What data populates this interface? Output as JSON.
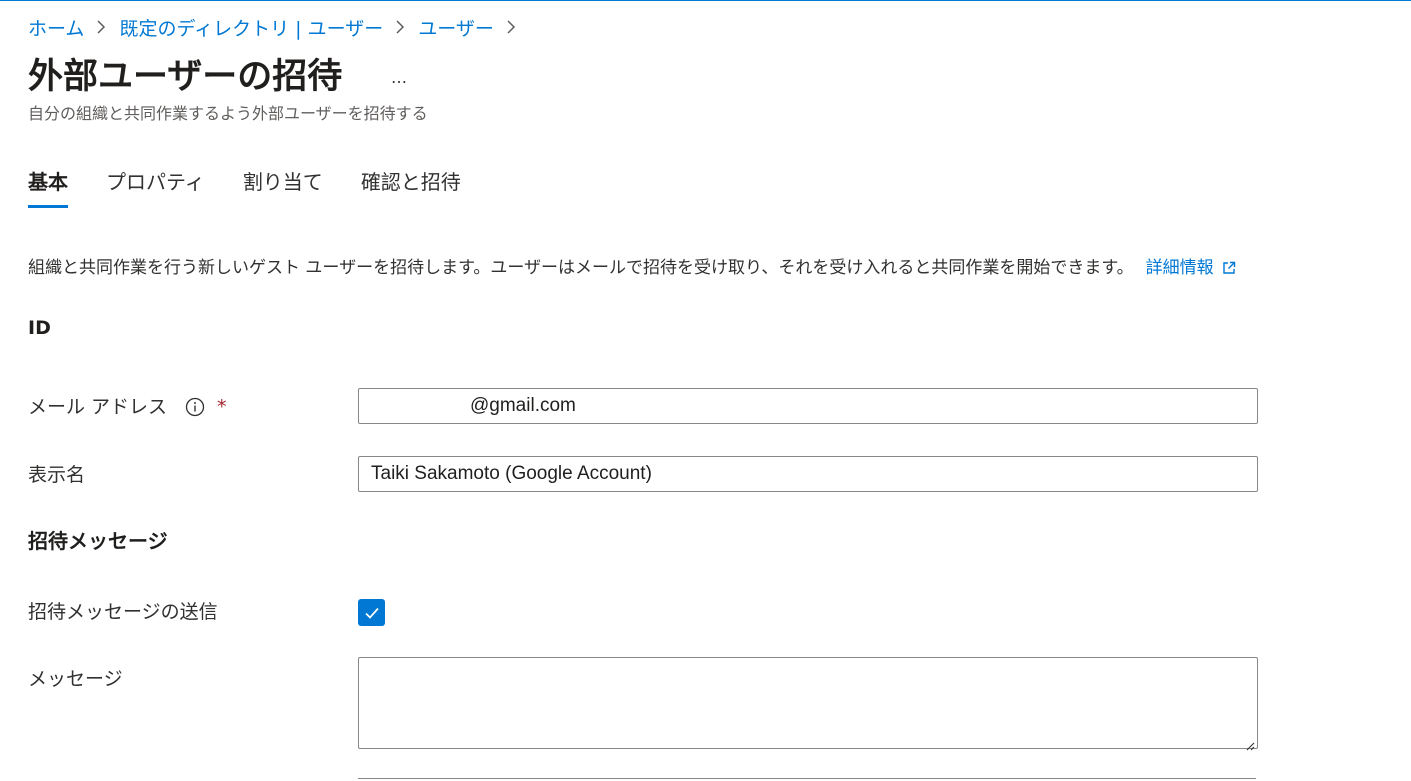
{
  "breadcrumb": [
    {
      "label": "ホーム"
    },
    {
      "label": "既定のディレクトリ | ユーザー"
    },
    {
      "label": "ユーザー"
    }
  ],
  "page": {
    "title": "外部ユーザーの招待",
    "more": "…",
    "subtitle": "自分の組織と共同作業するよう外部ユーザーを招待する"
  },
  "tabs": [
    {
      "label": "基本",
      "active": true
    },
    {
      "label": "プロパティ",
      "active": false
    },
    {
      "label": "割り当て",
      "active": false
    },
    {
      "label": "確認と招待",
      "active": false
    }
  ],
  "intro": {
    "text": "組織と共同作業を行う新しいゲスト ユーザーを招待します。ユーザーはメールで招待を受け取り、それを受け入れると共同作業を開始できます。",
    "learn_more": "詳細情報"
  },
  "identity": {
    "heading": "ID",
    "email_label": "メール アドレス",
    "required_mark": "*",
    "email_value": "@gmail.com",
    "display_name_label": "表示名",
    "display_name_value": "Taiki Sakamoto (Google Account)"
  },
  "invitation": {
    "heading": "招待メッセージ",
    "send_label": "招待メッセージの送信",
    "send_checked": true,
    "message_label": "メッセージ",
    "message_value": ""
  },
  "icons": {
    "chevron": "chevron-right-icon",
    "info": "info-icon",
    "external": "external-link-icon",
    "check": "checkmark-icon",
    "resize": "resize-grip-icon"
  },
  "colors": {
    "accent": "#0078d4",
    "required": "#a4262c",
    "text": "#323130",
    "border": "#8a8886"
  }
}
